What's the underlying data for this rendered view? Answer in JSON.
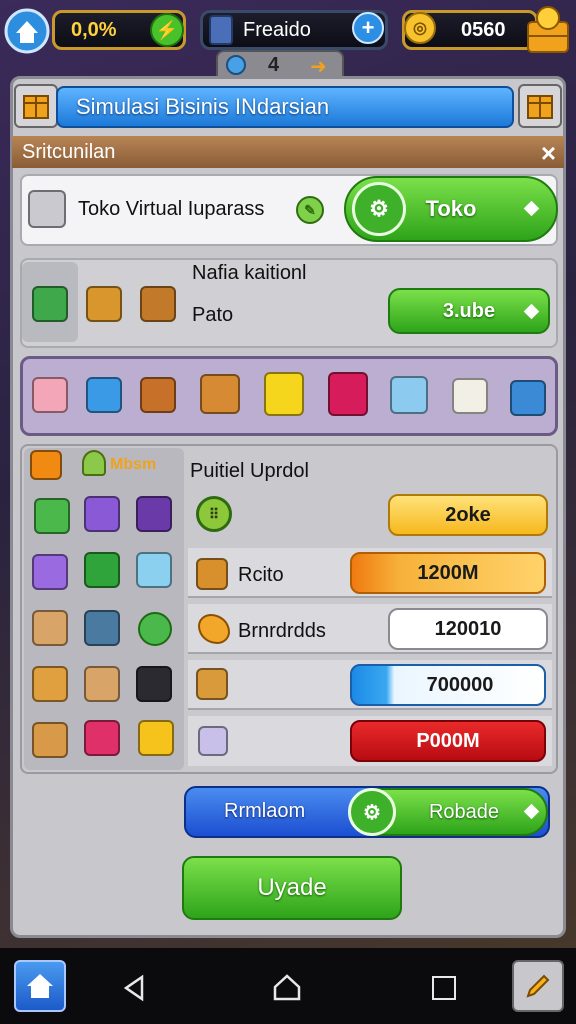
{
  "hud": {
    "percent": "0,0%",
    "center_label": "Freaido",
    "coins": "0560",
    "badge_number": "4"
  },
  "window": {
    "title": "Simulasi Bisinis INdarsian",
    "section": "Sritcunilan",
    "close_label": "×"
  },
  "store_row": {
    "name": "Toko Virtual Iuparass",
    "button": "Toko"
  },
  "product_row": {
    "heading": "Nafia kaitionl",
    "item": "Pato",
    "button": "3.ube"
  },
  "upgrade_panel": {
    "tag": "Mbsm",
    "heading": "Puitiel Uprdol",
    "rows": [
      {
        "label": "",
        "value": "2oke",
        "style": "yellow"
      },
      {
        "label": "Rcito",
        "value": "1200M",
        "style": "orange"
      },
      {
        "label": "Brnrdrdds",
        "value": "120010",
        "style": "white"
      },
      {
        "label": "",
        "value": "700000",
        "style": "blue"
      },
      {
        "label": "",
        "value": "P000M",
        "style": "red"
      }
    ]
  },
  "actions": {
    "left_button": "Rrmlaom",
    "right_button": "Robade",
    "main_button": "Uyade"
  },
  "colors": {
    "accent_blue": "#1c79d8",
    "accent_green": "#2ea41a",
    "accent_red": "#d0141a",
    "accent_orange": "#f08a12"
  }
}
